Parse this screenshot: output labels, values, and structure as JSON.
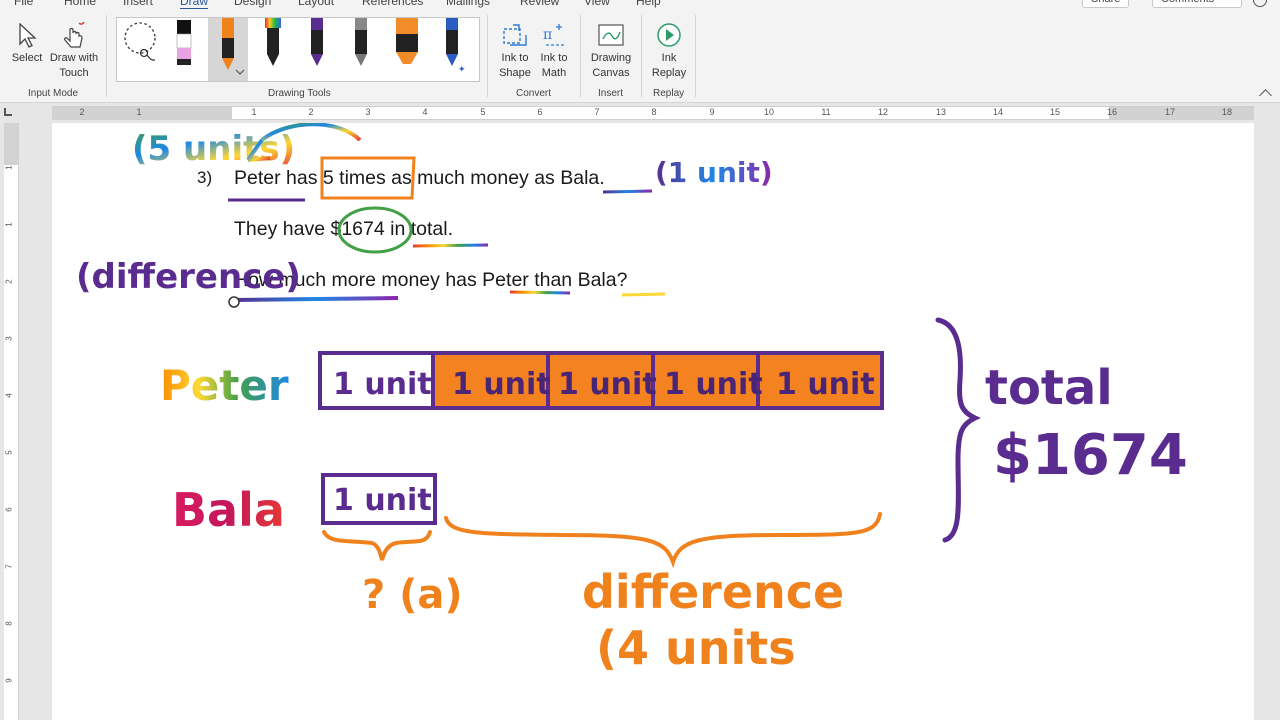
{
  "ribbon_tabs": [
    "File",
    "Home",
    "Insert",
    "Draw",
    "Design",
    "Layout",
    "References",
    "Mailings",
    "Review",
    "View",
    "Help"
  ],
  "active_tab": "Draw",
  "share_label": "Share",
  "comments_label": "Comments",
  "input_mode": {
    "select_label": "Select",
    "draw_touch_label_1": "Draw with",
    "draw_touch_label_2": "Touch",
    "group_label": "Input Mode"
  },
  "drawing_tools": {
    "group_label": "Drawing Tools",
    "pens": [
      {
        "name": "lasso-select-tool",
        "color": "#000000"
      },
      {
        "name": "pencil-pen",
        "color": "#e9a2e3"
      },
      {
        "name": "orange-pen",
        "color": "#f0821e"
      },
      {
        "name": "rainbow-pen",
        "color": "#d44040"
      },
      {
        "name": "purple-pen",
        "color": "#5b2c8f"
      },
      {
        "name": "galaxy-pen",
        "color": "#666666"
      },
      {
        "name": "orange-highlighter",
        "color": "#f28c28"
      },
      {
        "name": "ocean-pen",
        "color": "#2a5cc2"
      }
    ]
  },
  "convert": {
    "ink_shape_1": "Ink to",
    "ink_shape_2": "Shape",
    "ink_math_1": "Ink to",
    "ink_math_2": "Math",
    "group_label": "Convert"
  },
  "insert": {
    "canvas_1": "Drawing",
    "canvas_2": "Canvas",
    "group_label": "Insert"
  },
  "replay": {
    "ink_replay_1": "Ink",
    "ink_replay_2": "Replay",
    "group_label": "Replay"
  },
  "ruler": {
    "h_numbers": [
      "2",
      "1",
      "1",
      "2",
      "3",
      "4",
      "5",
      "6",
      "7",
      "8",
      "9",
      "10",
      "11",
      "12",
      "13",
      "14",
      "15",
      "16",
      "17",
      "18"
    ],
    "v_numbers": [
      "1",
      "1",
      "2",
      "3",
      "4",
      "5",
      "6",
      "7",
      "8",
      "9"
    ]
  },
  "document": {
    "question_number": "3)",
    "line1": "Peter has 5 times as much money as Bala.",
    "line2": "They have $1674 in total.",
    "line3": "How much more money has Peter than Bala?"
  },
  "ink_text": {
    "five_units": "(5 units)",
    "one_unit_note": "(1 unit)",
    "difference_note": "(difference)",
    "peter_label": "Peter",
    "bala_label": "Bala",
    "unit_label": "1 unit",
    "total_label": "total",
    "total_value": "$1674",
    "question_a": "? (a)",
    "difference_label": "difference",
    "four_units": "(4 units"
  },
  "colors": {
    "accent": "#2b579a",
    "orange": "#f0821e",
    "purple": "#5b2c8f"
  }
}
